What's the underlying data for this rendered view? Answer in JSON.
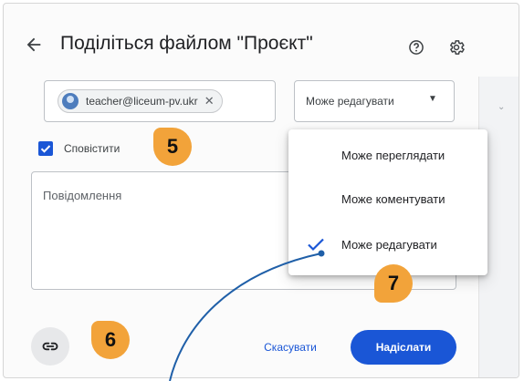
{
  "dialog": {
    "title": "Поділіться файлом \"Проєкт\"",
    "recipient_email": "teacher@liceum-pv.ukr",
    "permission_selected": "Може редагувати",
    "notify_label": "Сповістити",
    "notify_checked": true,
    "message_placeholder": "Повідомлення",
    "cancel_label": "Скасувати",
    "send_label": "Надіслати"
  },
  "permission_menu": {
    "items": [
      {
        "label": "Може переглядати",
        "checked": false
      },
      {
        "label": "Може коментувати",
        "checked": false
      },
      {
        "label": "Може редагувати",
        "checked": true
      }
    ]
  },
  "callouts": {
    "notify": "5",
    "link": "6",
    "send": "7"
  },
  "icons": {
    "back": "arrow-left-icon",
    "help": "help-circle-icon",
    "settings": "gear-icon",
    "remove_chip": "close-icon",
    "dropdown": "caret-down-icon",
    "check": "checkmark-icon",
    "link": "link-icon"
  },
  "colors": {
    "accent": "#1a56d6",
    "callout": "#f2a33a",
    "pointer_line": "#1f5fa8"
  }
}
